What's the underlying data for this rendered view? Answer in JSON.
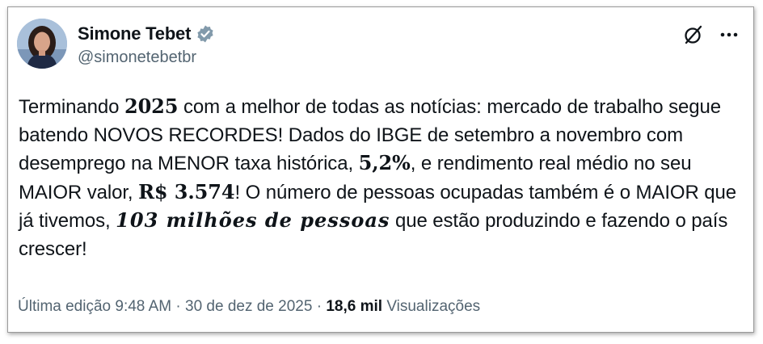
{
  "author": {
    "name": "Simone Tebet",
    "handle": "@simonetebetbr",
    "verified_icon": "verified-badge-icon",
    "avatar_icon": "avatar"
  },
  "actions": {
    "grok_icon": "grok-icon",
    "more_icon": "more-icon"
  },
  "tweet": {
    "segments": {
      "s1": "Terminando ",
      "b1": "2025",
      "s2": " com a melhor de todas as notícias: mercado de trabalho segue batendo NOVOS RECORDES! Dados do IBGE de setembro a novembro com desemprego na MENOR taxa histórica, ",
      "b2": "5,2%",
      "s3": ", e rendimento real médio no seu MAIOR valor, ",
      "b3": "R$ 3.574",
      "s4": "! O número de pessoas ocupadas também é o MAIOR que já tivemos, ",
      "b4": "103 milhões de pessoas",
      "s5": " que estão produzindo e fazendo o país crescer!"
    }
  },
  "meta": {
    "edited": "Última edição",
    "time": "9:48 AM",
    "separator1": " · ",
    "date": "30 de dez de 2025",
    "separator2": " · ",
    "views_count": "18,6 mil",
    "views_label": "Visualizações"
  },
  "colors": {
    "text": "#0f1419",
    "secondary": "#536471",
    "verified_badge": "#829aab"
  }
}
